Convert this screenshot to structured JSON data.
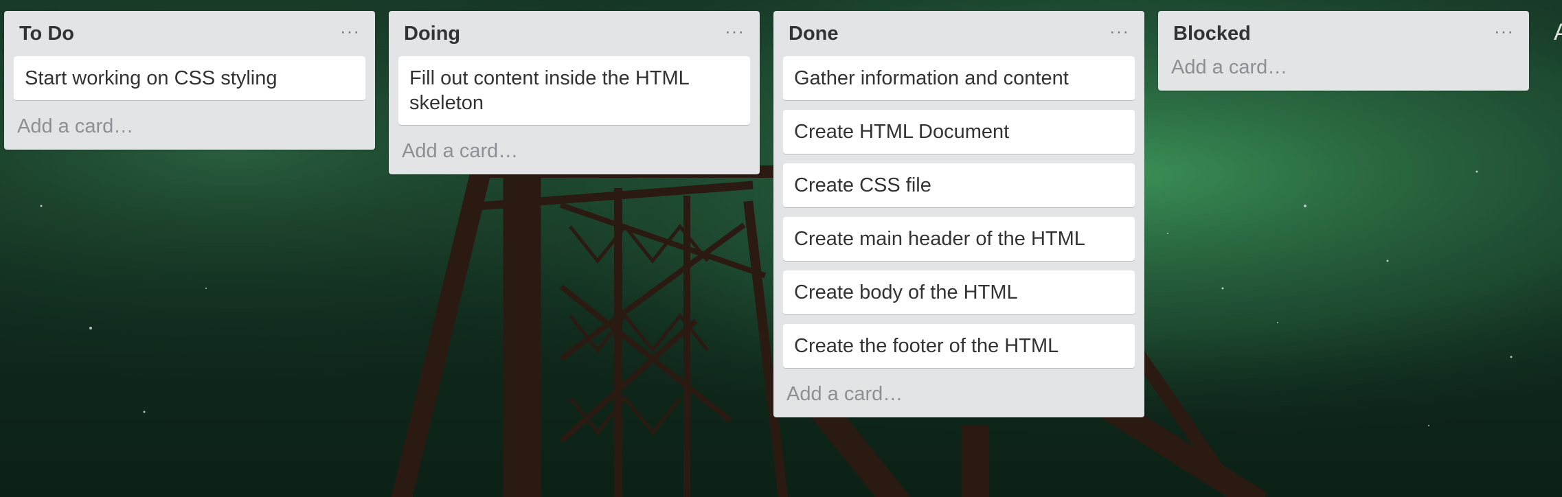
{
  "board": {
    "menu_icon": "ellipsis-icon",
    "lists": [
      {
        "title": "To Do",
        "menu_label": "···",
        "cards": [
          "Start working on CSS styling"
        ],
        "add_label": "Add a card…"
      },
      {
        "title": "Doing",
        "menu_label": "···",
        "cards": [
          "Fill out content inside the HTML skeleton"
        ],
        "add_label": "Add a card…"
      },
      {
        "title": "Done",
        "menu_label": "···",
        "cards": [
          "Gather information and content",
          "Create HTML Document",
          "Create CSS file",
          "Create main header of the HTML",
          "Create body of the HTML",
          "Create the footer of the HTML"
        ],
        "add_label": "Add a card…"
      },
      {
        "title": "Blocked",
        "menu_label": "···",
        "cards": [],
        "add_label": "Add a card…"
      }
    ],
    "edge_text": "A"
  },
  "colors": {
    "list_bg": "#e3e4e6",
    "card_bg": "#ffffff",
    "text": "#333333",
    "muted": "#8c8f93",
    "sky_green": "#2f7a4a",
    "bridge": "#2a1a12"
  }
}
